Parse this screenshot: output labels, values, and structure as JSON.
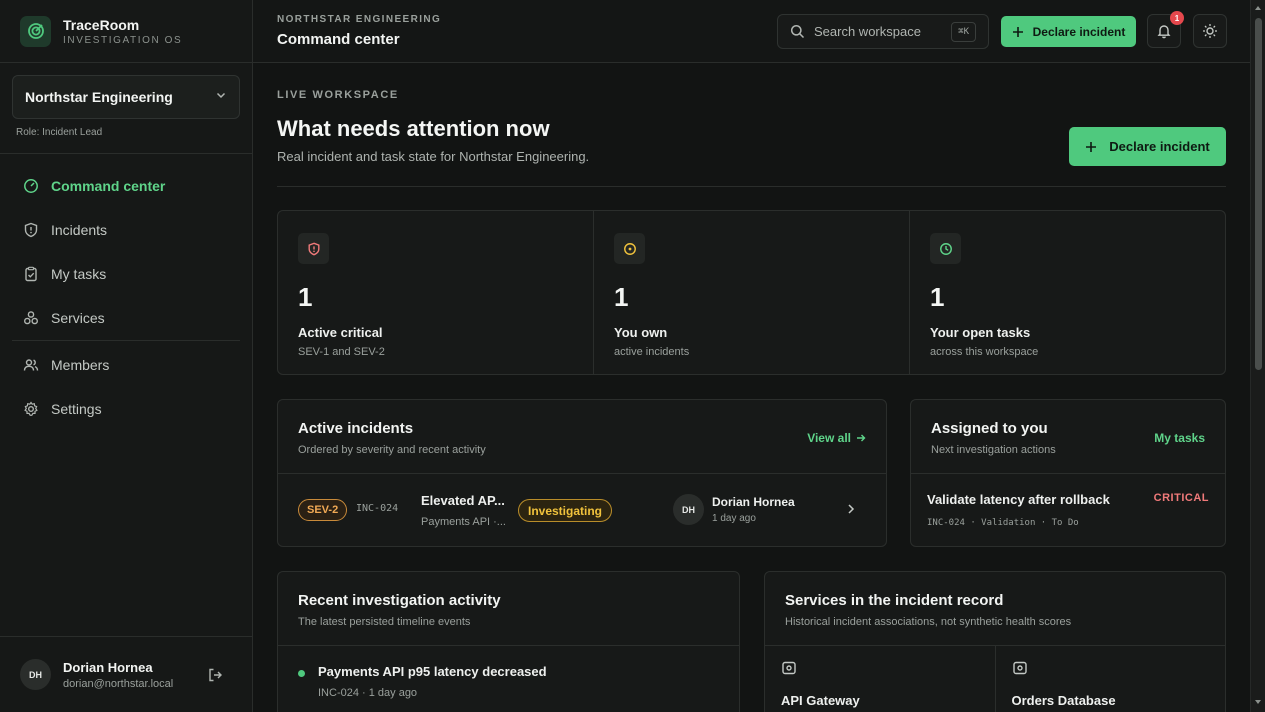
{
  "brand": {
    "name": "TraceRoom",
    "subtitle": "INVESTIGATION OS"
  },
  "org": {
    "name": "Northstar Engineering",
    "role": "Role: Incident Lead"
  },
  "nav": {
    "command_center": "Command center",
    "incidents": "Incidents",
    "my_tasks": "My tasks",
    "services": "Services",
    "members": "Members",
    "settings": "Settings"
  },
  "user": {
    "name": "Dorian Hornea",
    "email": "dorian@northstar.local",
    "initials": "DH"
  },
  "topbar": {
    "org": "NORTHSTAR ENGINEERING",
    "page": "Command center",
    "search_placeholder": "Search workspace",
    "shortcut": "⌘K",
    "declare_label": "Declare incident",
    "notification_count": "1"
  },
  "hero": {
    "eyebrow": "LIVE WORKSPACE",
    "title": "What needs attention now",
    "subtitle": "Real incident and task state for Northstar Engineering.",
    "declare_label": "Declare incident"
  },
  "stats": [
    {
      "value": "1",
      "label": "Active critical",
      "sub": "SEV-1 and SEV-2",
      "icon": "shield-alert-icon",
      "color": "#f07a7a"
    },
    {
      "value": "1",
      "label": "You own",
      "sub": "active incidents",
      "icon": "target-icon",
      "color": "#f0c23c"
    },
    {
      "value": "1",
      "label": "Your open tasks",
      "sub": "across this workspace",
      "icon": "clock-icon",
      "color": "#5fd48a"
    }
  ],
  "active_incidents": {
    "title": "Active incidents",
    "subtitle": "Ordered by severity and recent activity",
    "link": "View all",
    "rows": [
      {
        "severity": "SEV-2",
        "id": "INC-024",
        "title": "Elevated AP...",
        "service": "Payments API ·...",
        "status": "Investigating",
        "owner_initials": "DH",
        "owner": "Dorian Hornea",
        "time": "1 day ago"
      }
    ]
  },
  "assigned": {
    "title": "Assigned to you",
    "subtitle": "Next investigation actions",
    "link": "My tasks",
    "task": {
      "title": "Validate latency after rollback",
      "meta": "INC-024 · Validation · To Do",
      "priority": "CRITICAL"
    }
  },
  "activity": {
    "title": "Recent investigation activity",
    "subtitle": "The latest persisted timeline events",
    "items": [
      {
        "title": "Payments API p95 latency decreased",
        "meta": "INC-024 · 1 day ago"
      }
    ]
  },
  "services": {
    "title": "Services in the incident record",
    "subtitle": "Historical incident associations, not synthetic health scores",
    "items": [
      {
        "name": "API Gateway"
      },
      {
        "name": "Orders Database"
      }
    ]
  },
  "colors": {
    "accent": "#4fc97e",
    "warning": "#f0c23c",
    "danger": "#f07a7a",
    "background": "#121413"
  }
}
